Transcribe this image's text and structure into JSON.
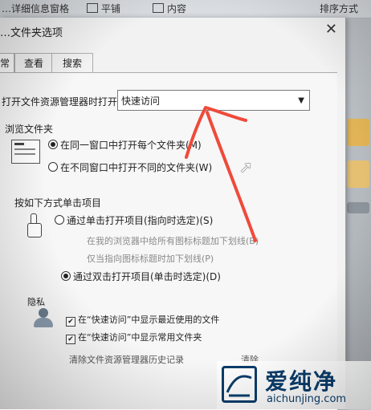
{
  "background": {
    "toolbar": {
      "left_partial": "…详细信息窗格",
      "tile": "平铺",
      "content": "内容",
      "sort": "排序方式"
    }
  },
  "dialog": {
    "title": "…文件夹选项",
    "close_glyph": "✕",
    "tabs": [
      {
        "label": "常规"
      },
      {
        "label": "查看"
      },
      {
        "label": "搜索"
      }
    ],
    "open_explorer_label": "打开文件资源管理器时打开:",
    "open_explorer_value": "快速访问",
    "browse": {
      "title": "浏览文件夹",
      "option_same": "在同一窗口中打开每个文件夹(M)",
      "option_new": "在不同窗口中打开不同的文件夹(W)",
      "selected": "option_same"
    },
    "click": {
      "title": "按如下方式单击项目",
      "option_single": "通过单击打开项目(指向时选定)(S)",
      "sub_browser": "在我的浏览器中给所有图标标题加下划线(B)",
      "sub_hover": "仅当指向图标标题时加下划线(P)",
      "option_double": "通过双击打开项目(单击时选定)(D)",
      "selected": "option_double"
    },
    "privacy": {
      "title": "隐私",
      "show_recent": "在“快速访问”中显示最近使用的文件",
      "show_frequent": "在“快速访问”中显示常用文件夹",
      "clear_history": "清除文件资源管理器历史记录",
      "clear_button": "清除",
      "show_recent_checked": true,
      "show_frequent_checked": true
    }
  },
  "watermark": {
    "cn": "爱纯净",
    "en": "aichunjing.com"
  },
  "colors": {
    "annotation_arrow": "#f04a3a",
    "watermark": "#0a3d6b"
  }
}
